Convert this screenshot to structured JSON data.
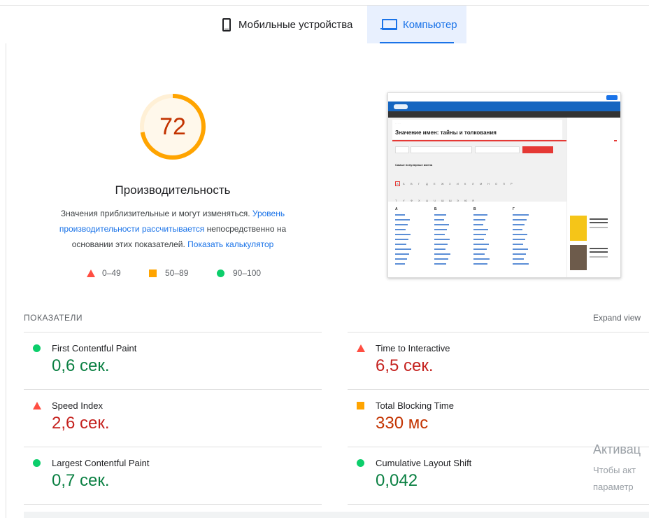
{
  "tabs": [
    {
      "label": "Мобильные устройства",
      "icon": "phone-icon",
      "selected": false
    },
    {
      "label": "Компьютер",
      "icon": "laptop-icon",
      "selected": true
    }
  ],
  "performance": {
    "score": 72,
    "score_fraction": 0.72,
    "title": "Производительность",
    "desc_part1": "Значения приблизительные и могут изменяться. ",
    "desc_link1": "Уровень производительности рассчитывается",
    "desc_part2": " непосредственно на основании этих показателей. ",
    "desc_link2": "Показать калькулятор",
    "colors": {
      "average": "#ffa400",
      "average_text": "#c33300",
      "track": "#fff3e0"
    }
  },
  "legend": {
    "fail": "0–49",
    "average": "50–89",
    "pass": "90–100"
  },
  "thumbnail": {
    "heading": "Значение имен: тайны и толкования",
    "popular": "Самые популярные имена",
    "letters": [
      "А",
      "Б",
      "В",
      "Г",
      "Д",
      "Е",
      "Ж",
      "З",
      "И",
      "К",
      "Л",
      "М",
      "Н",
      "О",
      "П",
      "Р",
      "С",
      "Т",
      "У",
      "Ф",
      "Х",
      "Ц",
      "Ч",
      "Ш",
      "Щ",
      "Э",
      "Ю",
      "Я"
    ],
    "column_letters": [
      "А",
      "Б",
      "В",
      "Г"
    ]
  },
  "metrics": {
    "header": "ПОКАЗАТЕЛИ",
    "expand_label": "Expand view",
    "items": [
      {
        "label": "First Contentful Paint",
        "value": "0,6 сек.",
        "status": "pass"
      },
      {
        "label": "Time to Interactive",
        "value": "6,5 сек.",
        "status": "fail"
      },
      {
        "label": "Speed Index",
        "value": "2,6 сек.",
        "status": "fail"
      },
      {
        "label": "Total Blocking Time",
        "value": "330 мс",
        "status": "average"
      },
      {
        "label": "Largest Contentful Paint",
        "value": "0,7 сек.",
        "status": "pass"
      },
      {
        "label": "Cumulative Layout Shift",
        "value": "0,042",
        "status": "pass"
      }
    ]
  },
  "watermark": {
    "line1": "Активац",
    "line2": "Чтобы акт",
    "line3": "параметр"
  }
}
